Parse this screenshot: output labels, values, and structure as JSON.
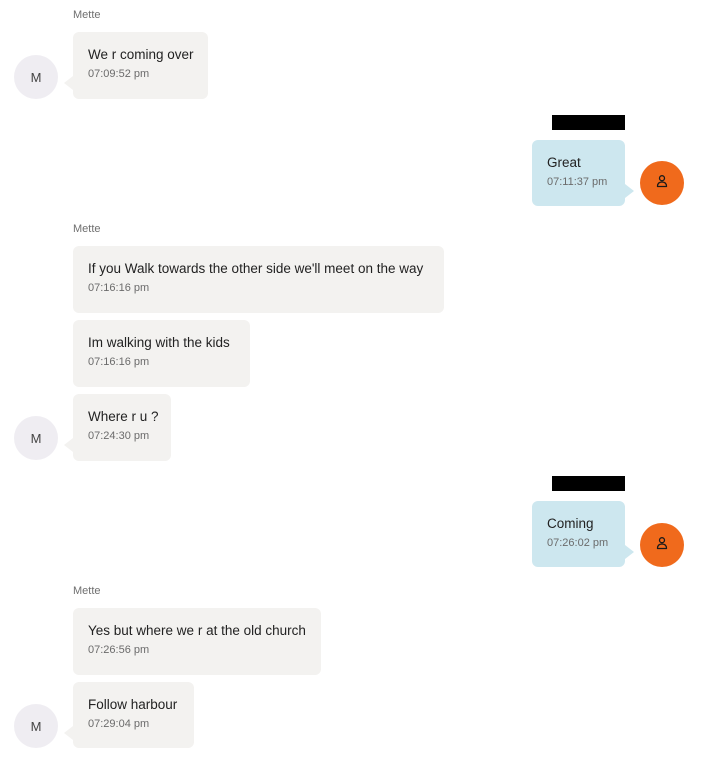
{
  "contact": {
    "name": "Mette",
    "initial": "M"
  },
  "colors": {
    "incoming_bubble": "#f3f2f0",
    "outgoing_bubble": "#cde7ef",
    "own_avatar": "#f06a1c",
    "contact_avatar": "#efedf2",
    "redaction": "#000000"
  },
  "icons": {
    "own_avatar": "person-outline-icon"
  },
  "messages": [
    {
      "direction": "incoming",
      "sender": "Mette",
      "text": "We r coming over",
      "time": "07:09:52 pm"
    },
    {
      "direction": "outgoing",
      "sender_redacted": true,
      "text": "Great",
      "time": "07:11:37 pm"
    },
    {
      "direction": "incoming",
      "sender": "Mette",
      "text": "If you Walk towards the other side we'll meet on the way",
      "time": "07:16:16 pm"
    },
    {
      "direction": "incoming",
      "text": "Im walking with the kids",
      "time": "07:16:16 pm"
    },
    {
      "direction": "incoming",
      "text": "Where r u ?",
      "time": "07:24:30 pm"
    },
    {
      "direction": "outgoing",
      "sender_redacted": true,
      "text": "Coming",
      "time": "07:26:02 pm"
    },
    {
      "direction": "incoming",
      "sender": "Mette",
      "text": "Yes but where we r at the old church",
      "time": "07:26:56 pm"
    },
    {
      "direction": "incoming",
      "text": "Follow harbour",
      "time": "07:29:04 pm"
    }
  ]
}
